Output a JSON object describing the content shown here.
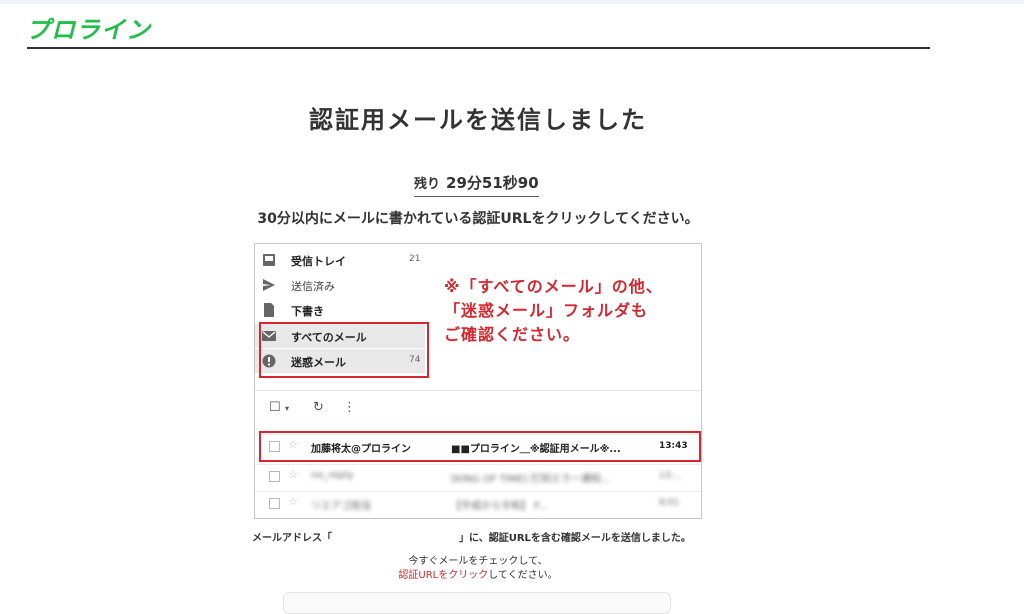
{
  "brand": {
    "logo_text": "プロライン",
    "color": "#1fbf4a"
  },
  "page": {
    "title": "認証用メールを送信しました",
    "timer_label": "残り",
    "timer_value": "29分51秒90",
    "instruction": "30分以内にメールに書かれている認証URLをクリックしてください。"
  },
  "mail_screenshot": {
    "folders": [
      {
        "icon": "inbox-icon",
        "label": "受信トレイ",
        "count": "21"
      },
      {
        "icon": "send-icon",
        "label": "送信済み",
        "count": ""
      },
      {
        "icon": "draft-icon",
        "label": "下書き",
        "count": ""
      },
      {
        "icon": "mail-icon",
        "label": "すべてのメール",
        "count": ""
      },
      {
        "icon": "spam-icon",
        "label": "迷惑メール",
        "count": "74"
      }
    ],
    "note_lines": [
      "※「すべてのメール」の他、",
      "「迷惑メール」フォルダも",
      "ご確認ください。"
    ],
    "toolbar": {
      "checkbox": "☐",
      "dropdown": "▾",
      "refresh": "↻",
      "more": "⋮"
    },
    "emails": [
      {
        "sender": "加藤将太@プロライン",
        "subject": "■■プロライン＿※認証用メール※...",
        "time": "13:43"
      },
      {
        "sender": "no_reply",
        "subject": "[KING OF TIME] 打刻エラー通知...",
        "time": "13:..."
      },
      {
        "sender": "リエアゴ担当",
        "subject": "【平成から令和】 F...",
        "time": "8:01"
      }
    ],
    "accent_color": "#d7262d"
  },
  "address_line": {
    "prefix": "メールアドレス「",
    "suffix": "」に、認証URLを含む確認メールを送信しました。"
  },
  "check_prompt": {
    "line1": "今すぐメールをチェックして、",
    "line2_link": "認証URLをクリック",
    "line2_rest": "してください。"
  }
}
